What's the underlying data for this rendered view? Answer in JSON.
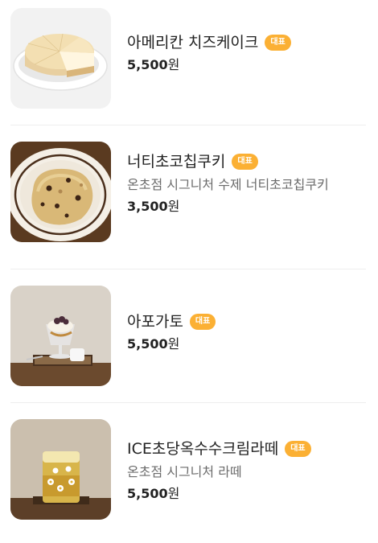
{
  "menu": {
    "items": [
      {
        "name": "아메리칸 치즈케이크",
        "badge": "대표",
        "description": "",
        "price_amount": "5,500",
        "price_unit": "원",
        "image_icon": "cheesecake-image"
      },
      {
        "name": "너티초코칩쿠키",
        "badge": "대표",
        "description": "온초점 시그니처 수제 너티초코칩쿠키",
        "price_amount": "3,500",
        "price_unit": "원",
        "image_icon": "cookie-image"
      },
      {
        "name": "아포가토",
        "badge": "대표",
        "description": "",
        "price_amount": "5,500",
        "price_unit": "원",
        "image_icon": "affogato-image"
      },
      {
        "name": "ICE초당옥수수크림라떼",
        "badge": "대표",
        "description": "온초점 시그니처 라떼",
        "price_amount": "5,500",
        "price_unit": "원",
        "image_icon": "corn-latte-image"
      }
    ]
  },
  "colors": {
    "badge": "#fbb034",
    "text": "#222222",
    "description": "#6b6b6b",
    "divider": "#eeeeee"
  }
}
